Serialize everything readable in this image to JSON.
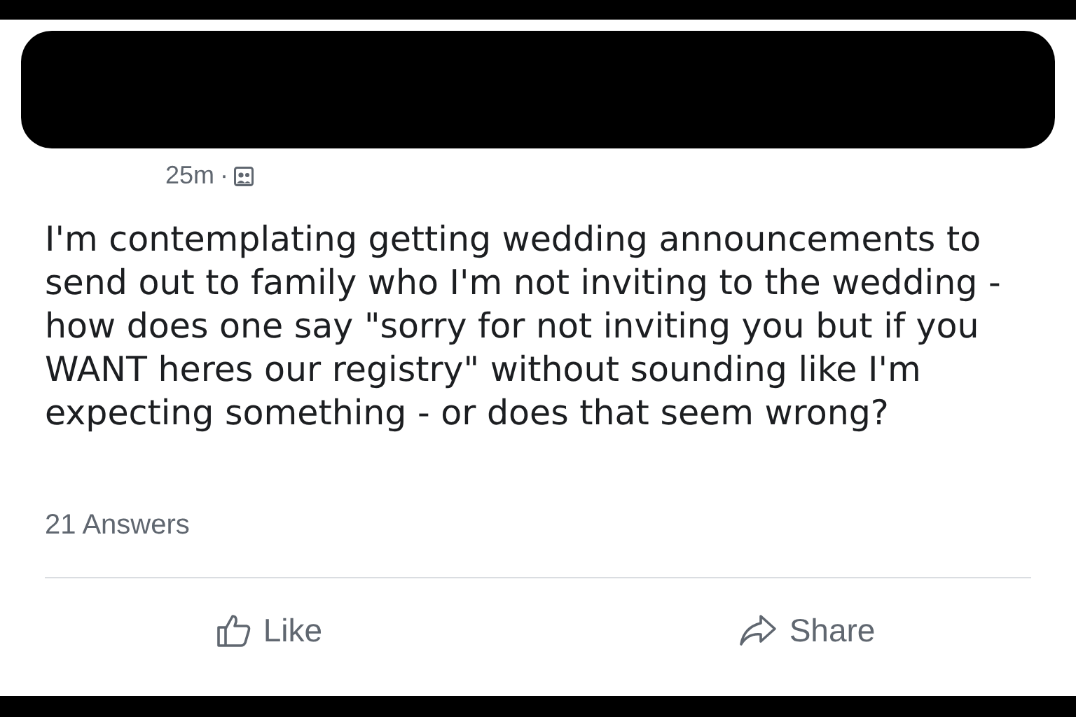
{
  "post": {
    "time": "25m",
    "separator": "·",
    "body": "I'm contemplating getting wedding announcements to send out to family who I'm not inviting to the wedding - how does one say \"sorry for not inviting you but if you WANT heres our registry\" without sounding like I'm expecting something - or does that seem wrong?",
    "answers": "21 Answers"
  },
  "actions": [
    {
      "kind": "like",
      "label": "Like"
    },
    {
      "kind": "share",
      "label": "Share"
    }
  ]
}
